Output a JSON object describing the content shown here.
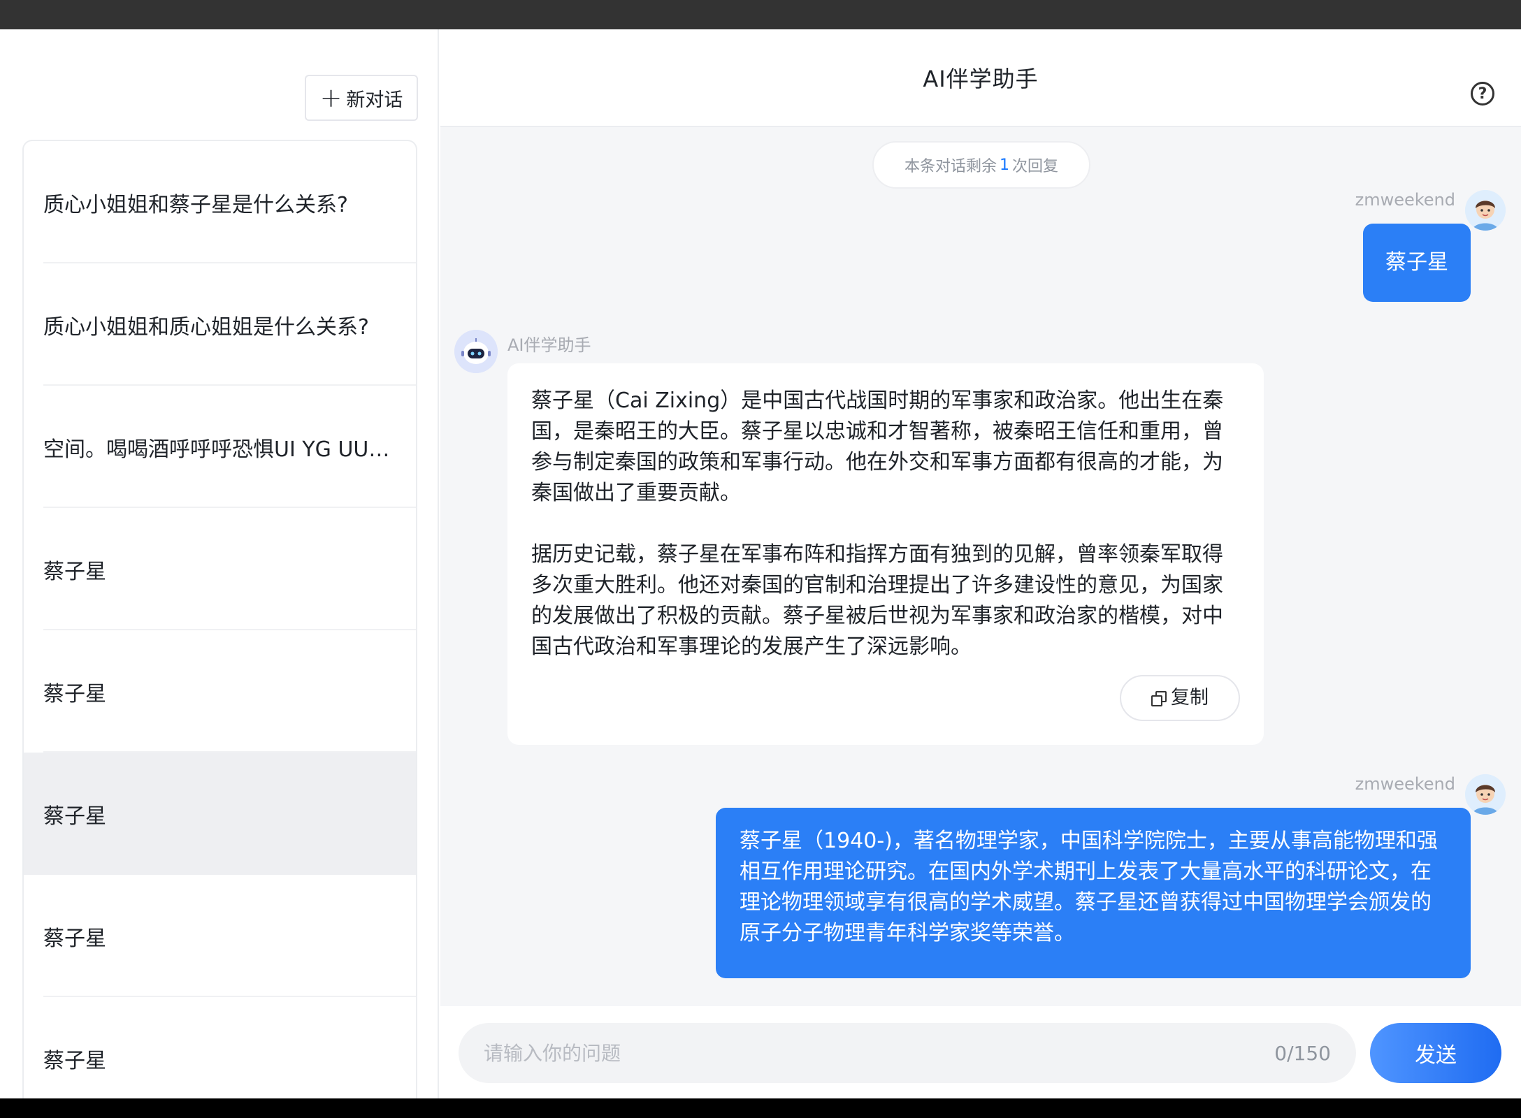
{
  "sidebar": {
    "new_chat_label": "新对话",
    "conversations": [
      {
        "title": "质心小姐姐和蔡子星是什么关系?"
      },
      {
        "title": "质心小姐姐和质心姐姐是什么关系?"
      },
      {
        "title": "空间。喝喝酒呼呼呼恐惧UI YG UU骨..."
      },
      {
        "title": "蔡子星"
      },
      {
        "title": "蔡子星"
      },
      {
        "title": "蔡子星",
        "active": true
      },
      {
        "title": "蔡子星"
      },
      {
        "title": "蔡子星"
      }
    ]
  },
  "header": {
    "title": "AI伴学助手"
  },
  "chat": {
    "remaining": {
      "prefix": "本条对话剩余",
      "count": "1",
      "suffix": "次回复"
    },
    "messages": [
      {
        "role": "user",
        "name": "zmweekend",
        "text": "蔡子星"
      },
      {
        "role": "bot",
        "name": "AI伴学助手",
        "paragraphs": [
          "蔡子星（Cai Zixing）是中国古代战国时期的军事家和政治家。他出生在秦国，是秦昭王的大臣。蔡子星以忠诚和才智著称，被秦昭王信任和重用，曾参与制定秦国的政策和军事行动。他在外交和军事方面都有很高的才能，为秦国做出了重要贡献。",
          "据历史记载，蔡子星在军事布阵和指挥方面有独到的见解，曾率领秦军取得多次重大胜利。他还对秦国的官制和治理提出了许多建设性的意见，为国家的发展做出了积极的贡献。蔡子星被后世视为军事家和政治家的楷模，对中国古代政治和军事理论的发展产生了深远影响。"
        ],
        "copy_label": "复制"
      },
      {
        "role": "user",
        "name": "zmweekend",
        "text": "蔡子星（1940-)，著名物理学家，中国科学院院士，主要从事高能物理和强相互作用理论研究。在国内外学术期刊上发表了大量高水平的科研论文，在理论物理领域享有很高的学术威望。蔡子星还曾获得过中国物理学会颁发的原子分子物理青年科学家奖等荣誉。"
      }
    ]
  },
  "input": {
    "placeholder": "请输入你的问题",
    "counter": "0/150",
    "send_label": "发送"
  },
  "colors": {
    "accent": "#2b7ff6",
    "active_item_bg": "#eeeff2",
    "chat_bg": "#f5f6f8"
  },
  "icons": {
    "new_chat": "plus-icon",
    "help": "help-circle-icon",
    "copy": "copy-icon",
    "user_avatar": "user-avatar",
    "bot_avatar": "robot-avatar"
  }
}
